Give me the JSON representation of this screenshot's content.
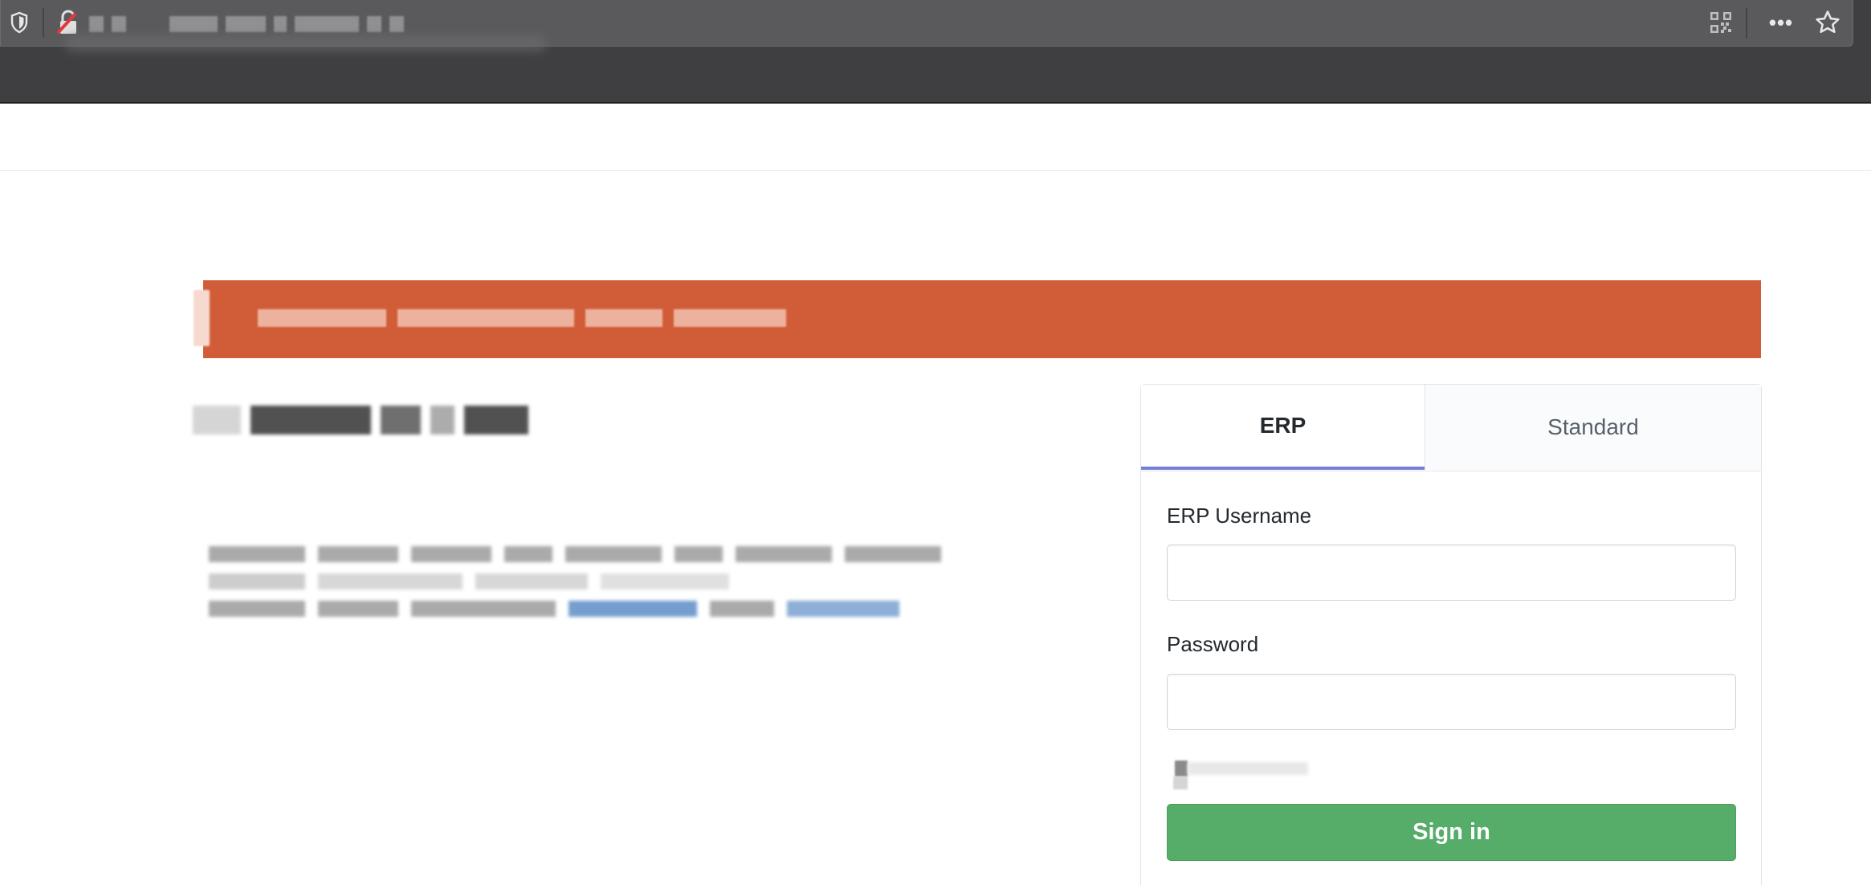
{
  "browser": {
    "toolbar_icons": [
      "shield-icon",
      "lock-icon",
      "qr-code-icon",
      "more-icon",
      "star-icon"
    ],
    "more_label": "•••"
  },
  "alert": {
    "color": "#d15c38"
  },
  "login": {
    "tabs": [
      {
        "label": "ERP",
        "active": true
      },
      {
        "label": "Standard",
        "active": false
      }
    ],
    "username_label": "ERP Username",
    "username_value": "",
    "password_label": "Password",
    "password_value": "",
    "submit_label": "Sign in",
    "accent_color": "#55ad69",
    "active_tab_color": "#7480d6"
  }
}
